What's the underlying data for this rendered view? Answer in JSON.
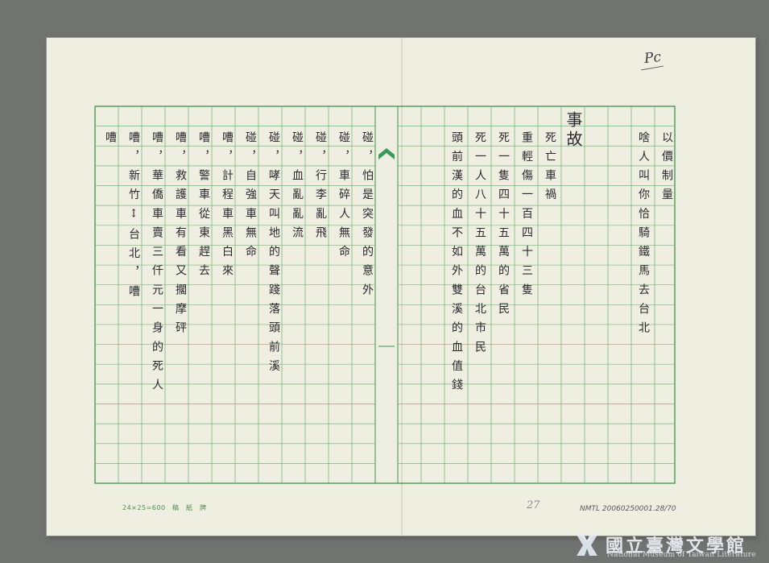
{
  "manuscript": {
    "page_mark": "Pc",
    "columns": [
      {
        "id": "r1",
        "text": "以價制量"
      },
      {
        "id": "r2",
        "text": "啥人叫你恰騎鐵馬去台北"
      },
      {
        "id": "r3",
        "text": "事故"
      },
      {
        "id": "r4",
        "text": "死亡車禍"
      },
      {
        "id": "r5",
        "text": "重輕傷一百四十三隻"
      },
      {
        "id": "r6",
        "text": "死一隻四十五萬的省民"
      },
      {
        "id": "r7",
        "text": "死一人八十五萬的台北市民"
      },
      {
        "id": "r8",
        "text": "頭前漢的血不如外雙溪的血值錢"
      },
      {
        "id": "l1",
        "text": "碰，怕是突發的意外"
      },
      {
        "id": "l2",
        "text": "碰，車碎人無命"
      },
      {
        "id": "l3",
        "text": "碰，行李亂飛"
      },
      {
        "id": "l4",
        "text": "碰，血亂亂流"
      },
      {
        "id": "l5",
        "text": "碰，哮天叫地的聲踐落頭前溪"
      },
      {
        "id": "l6",
        "text": "碰，自強車無命"
      },
      {
        "id": "l7",
        "text": "嘈，計程車黑白來"
      },
      {
        "id": "l8",
        "text": "嘈，警車從東趕去"
      },
      {
        "id": "l9",
        "text": "嘈，救護車有看又擱摩砰"
      },
      {
        "id": "l10",
        "text": "嘈，華僑車賣三仟元一身的死人"
      },
      {
        "id": "l11",
        "text": "嘈，新竹↕台北，嘈"
      },
      {
        "id": "l12",
        "text": "嘈"
      }
    ]
  },
  "footer": {
    "paper_spec": "24×25=600　稿　紙　牌",
    "handwritten_number": "27",
    "archive_id": "NMTL 20060250001.28/70"
  },
  "logo": {
    "title": "國立臺灣文學館",
    "subtitle": "National Museum of Taiwan Literature"
  },
  "colors": {
    "grid_line": "#7fb27f",
    "grid_frame": "#3f8f4f",
    "center_marker": "#3a9a5a",
    "ink": "#2a2a30"
  }
}
